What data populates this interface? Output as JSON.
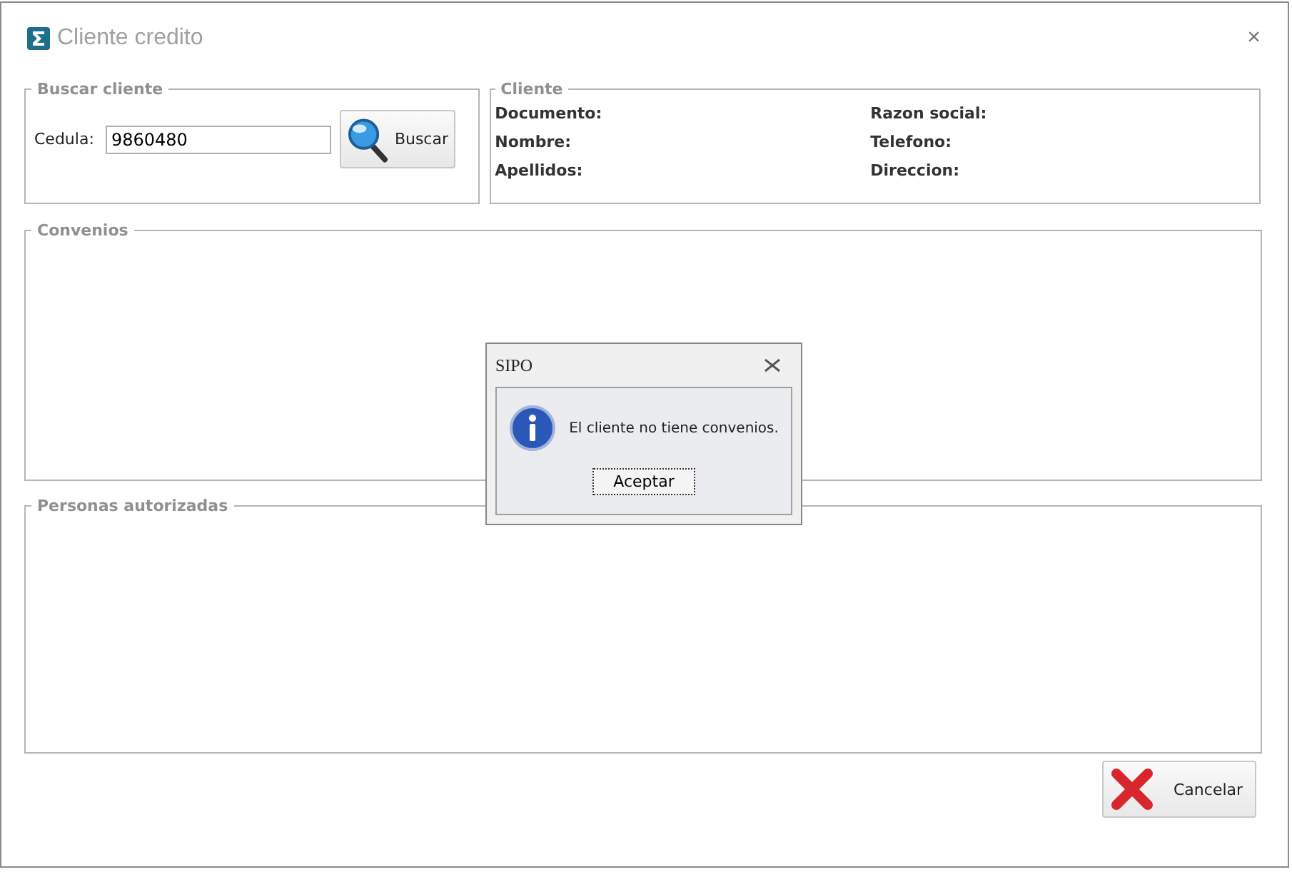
{
  "window": {
    "title": "Cliente credito",
    "close": "×"
  },
  "search_group": {
    "title": "Buscar cliente",
    "field_label": "Cedula:",
    "field_value": "9860480",
    "button": "Buscar"
  },
  "client_group": {
    "title": "Cliente",
    "fields": [
      {
        "label": "Documento:"
      },
      {
        "label": "Razon social:"
      },
      {
        "label": "Nombre:"
      },
      {
        "label": "Telefono:"
      },
      {
        "label": "Apellidos:"
      },
      {
        "label": "Direccion:"
      }
    ]
  },
  "convenios_group": {
    "title": "Convenios"
  },
  "personas_group": {
    "title": "Personas autorizadas"
  },
  "cancel_button": "Cancelar",
  "dialog": {
    "title": "SIPO",
    "message": "El cliente no tiene convenios.",
    "button": "Aceptar"
  }
}
